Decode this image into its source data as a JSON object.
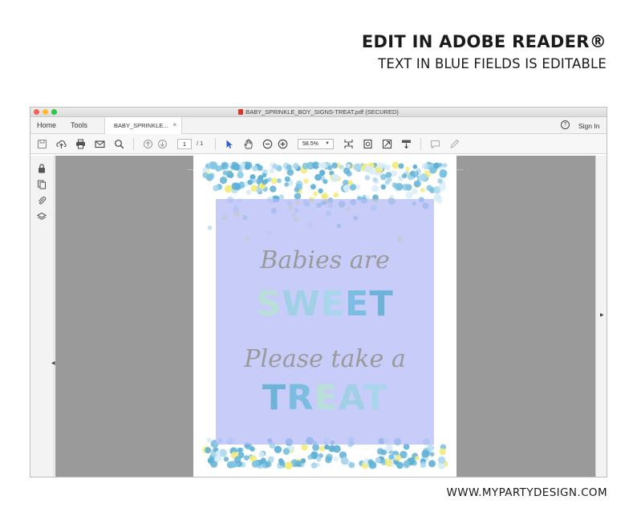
{
  "promo": {
    "headline": "EDIT IN ADOBE READER®",
    "subheadline": "TEXT IN BLUE FIELDS IS EDITABLE",
    "footer": "WWW.MYPARTYDESIGN.COM"
  },
  "window": {
    "title": "BABY_SPRINKLE_BOY_SIGNS-TREAT.pdf (SECURED)"
  },
  "tabs": {
    "home": "Home",
    "tools": "Tools",
    "document": "BABY_SPRINKLE...",
    "close": "×",
    "help": "?",
    "sign_in": "Sign In"
  },
  "toolbar": {
    "page_number": "1",
    "page_total": "/ 1",
    "zoom": "58.5%",
    "icons": [
      "save-icon",
      "upload-icon",
      "print-icon",
      "mail-icon",
      "search-icon",
      "page-up-icon",
      "page-down-icon",
      "select-arrow-icon",
      "hand-icon",
      "zoom-out-icon",
      "zoom-in-icon",
      "crop-icon",
      "rotate-icon",
      "fit-icon",
      "scroll-icon",
      "comment-icon",
      "pen-icon"
    ]
  },
  "left_rail": {
    "icons": [
      "lock-icon",
      "pages-icon",
      "attachment-icon",
      "layers-icon"
    ]
  },
  "sign": {
    "line1": "Babies are",
    "line2": [
      "S",
      "W",
      "E",
      "E",
      "T"
    ],
    "line3": "Please take a",
    "line4": [
      "T",
      "R",
      "E",
      "A",
      "T"
    ]
  },
  "colors": {
    "blue_field": "#b2baf5",
    "script_text": "#9a9a9a",
    "confetti_blue": "#5fb0d6",
    "confetti_light_blue": "#a9d7ee",
    "confetti_yellow": "#f2ec7a",
    "viewer_bg": "#9a9a9a"
  }
}
